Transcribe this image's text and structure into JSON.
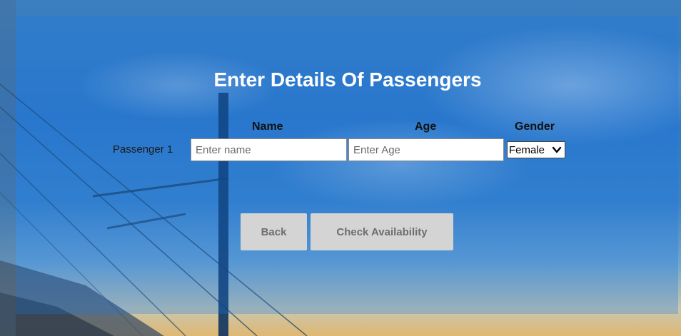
{
  "page": {
    "title": "Enter Details Of Passengers"
  },
  "table": {
    "headers": {
      "name": "Name",
      "age": "Age",
      "gender": "Gender"
    },
    "rows": [
      {
        "label": "Passenger 1",
        "name_value": "",
        "name_placeholder": "Enter name",
        "age_value": "",
        "age_placeholder": "Enter Age",
        "gender_selected": "Female"
      }
    ]
  },
  "actions": {
    "back_label": "Back",
    "check_label": "Check Availability"
  },
  "colors": {
    "overlay": "#1978e1",
    "button_bg": "#d4d4d4",
    "button_text": "#6e6e6e"
  },
  "icons": {
    "gender_dropdown": "chevron-down-icon"
  }
}
